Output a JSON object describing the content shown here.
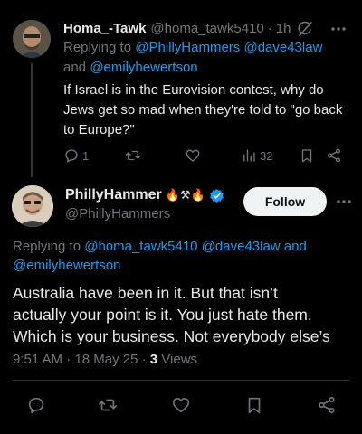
{
  "parent": {
    "name": "Homa_-Tawk",
    "handle": "@homa_tawk5410",
    "dot": "·",
    "time": "1h",
    "replying_prefix": "Replying to ",
    "replying_line1_users": "@PhillyHammers @dave43law",
    "replying_and": "and ",
    "replying_line2_user": "@emilyhewertson",
    "text_lines": [
      "If Israel is in the Eurovision contest, why do",
      "Jews get so mad when they're told to \"go back",
      "to Europe?\""
    ],
    "actions": {
      "reply_count": "1",
      "views_count": "32"
    }
  },
  "main": {
    "name": "PhillyHammer",
    "name_emoji": "🔥⚒🔥",
    "handle": "@PhillyHammers",
    "follow_label": "Follow",
    "replying_prefix": "Replying to ",
    "replying_line1_users": "@homa_tawk5410 @dave43law",
    "replying_and": " and",
    "replying_line2_user": "@emilyhewertson",
    "text_lines": [
      "Australia have been in it. But that isn’t",
      "actually your point is it. You just hate them.",
      "Which is your business. Not everybody else’s"
    ],
    "time": "9:51 AM",
    "sep1": " · ",
    "date": "18 May 25",
    "sep2": " · ",
    "views_count": "3",
    "views_label": " Views"
  },
  "colors": {
    "background": "#000000",
    "text": "#e7e9ea",
    "muted": "#71767b",
    "link": "#1d9bf0",
    "verified": "#1d9bf0"
  },
  "icons": [
    "grok-icon",
    "more-icon",
    "reply-icon",
    "retweet-icon",
    "like-icon",
    "views-icon",
    "bookmark-icon",
    "share-icon",
    "verified-icon"
  ]
}
